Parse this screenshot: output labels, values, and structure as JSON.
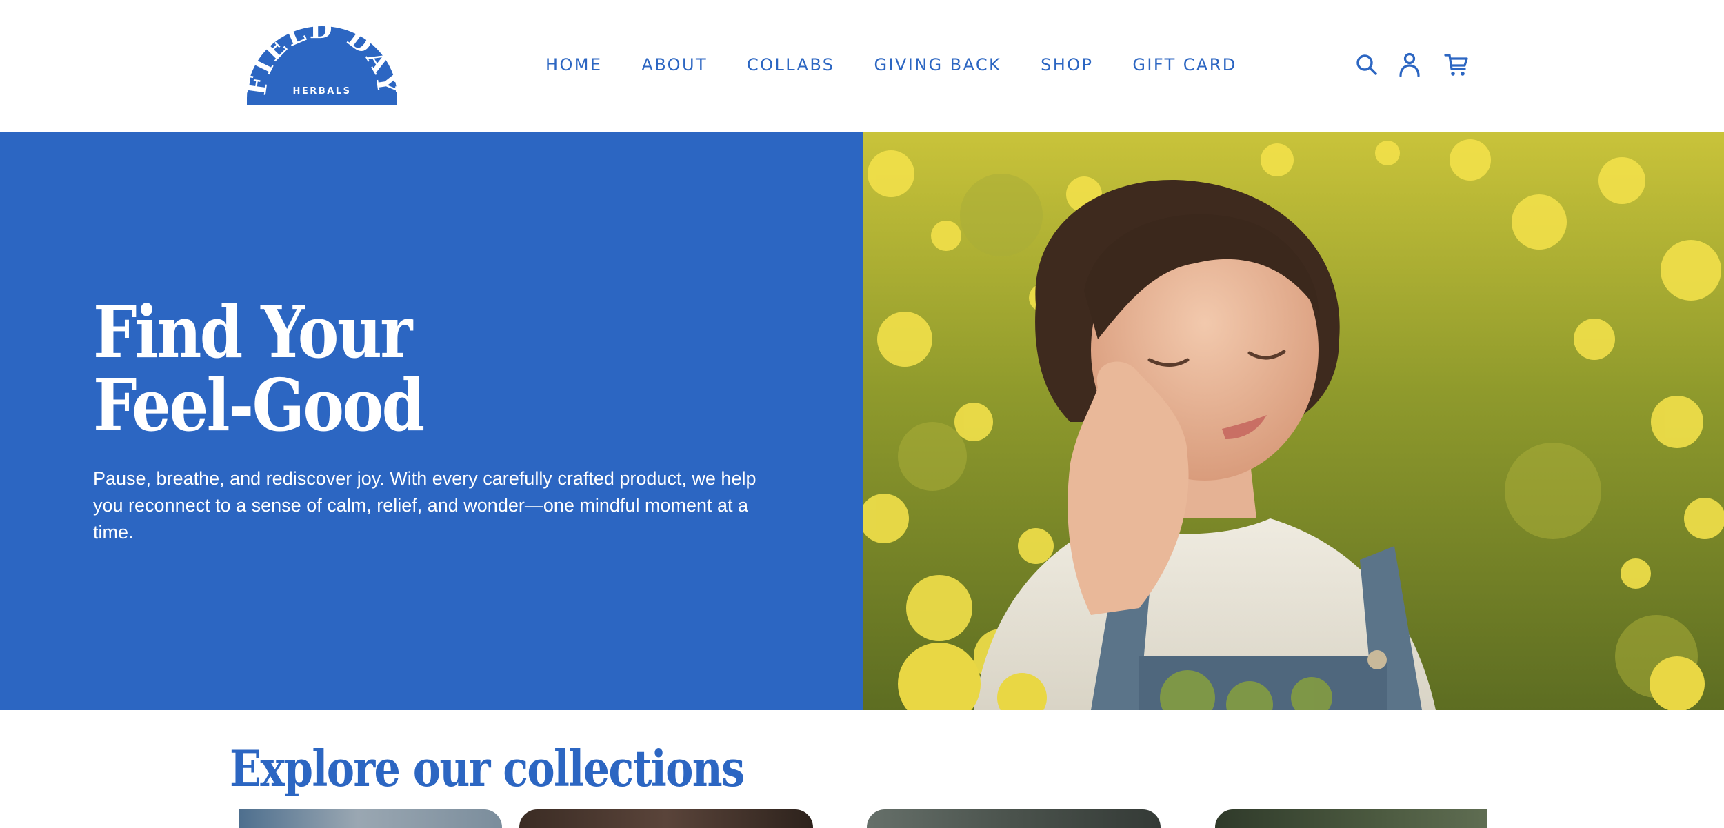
{
  "brand": {
    "logo_top_text": "FIELD DAY",
    "logo_bottom_text": "HERBALS",
    "color": "#2c66c2"
  },
  "nav": {
    "items": [
      {
        "label": "HOME"
      },
      {
        "label": "ABOUT"
      },
      {
        "label": "COLLABS"
      },
      {
        "label": "GIVING BACK"
      },
      {
        "label": "SHOP"
      },
      {
        "label": "GIFT CARD"
      }
    ]
  },
  "header_icons": [
    "search-icon",
    "account-icon",
    "cart-icon"
  ],
  "hero": {
    "title_line1": "Find Your",
    "title_line2": "Feel-Good",
    "description": "Pause, breathe, and rediscover joy. With every carefully crafted product, we help you reconnect to a sense of calm, relief, and wonder—one mindful moment at a time.",
    "background_color": "#2c66c2",
    "image_subject": "woman-resting-in-yellow-flower-field"
  },
  "collections": {
    "title": "Explore our collections",
    "cards": [
      {
        "name": "collection-card-1"
      },
      {
        "name": "collection-card-2"
      },
      {
        "name": "collection-card-3"
      },
      {
        "name": "collection-card-4"
      }
    ]
  }
}
